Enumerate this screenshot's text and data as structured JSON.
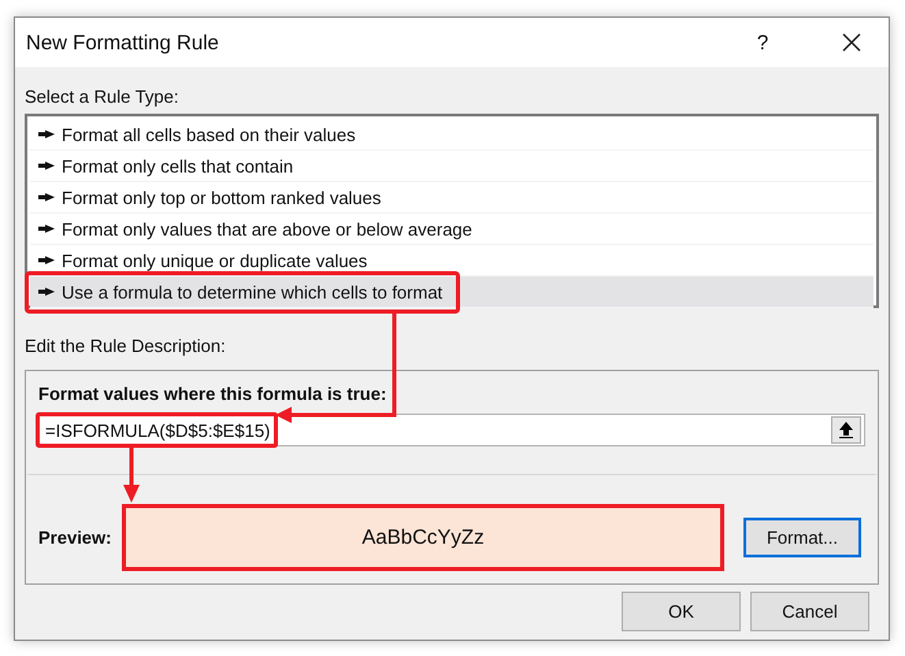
{
  "window": {
    "title": "New Formatting Rule",
    "help": "?"
  },
  "rule_type_label": "Select a Rule Type:",
  "rule_types": [
    {
      "label": "Format all cells based on their values",
      "selected": false
    },
    {
      "label": "Format only cells that contain",
      "selected": false
    },
    {
      "label": "Format only top or bottom ranked values",
      "selected": false
    },
    {
      "label": "Format only values that are above or below average",
      "selected": false
    },
    {
      "label": "Format only unique or duplicate values",
      "selected": false
    },
    {
      "label": "Use a formula to determine which cells to format",
      "selected": true
    }
  ],
  "description_label": "Edit the Rule Description:",
  "formula_label": "Format values where this formula is true:",
  "formula": {
    "value": "=ISFORMULA($D$5:$E$15)"
  },
  "preview": {
    "label": "Preview:",
    "sample": "AaBbCcYyZz"
  },
  "format_button": "Format...",
  "buttons": [
    "OK",
    "Cancel"
  ]
}
